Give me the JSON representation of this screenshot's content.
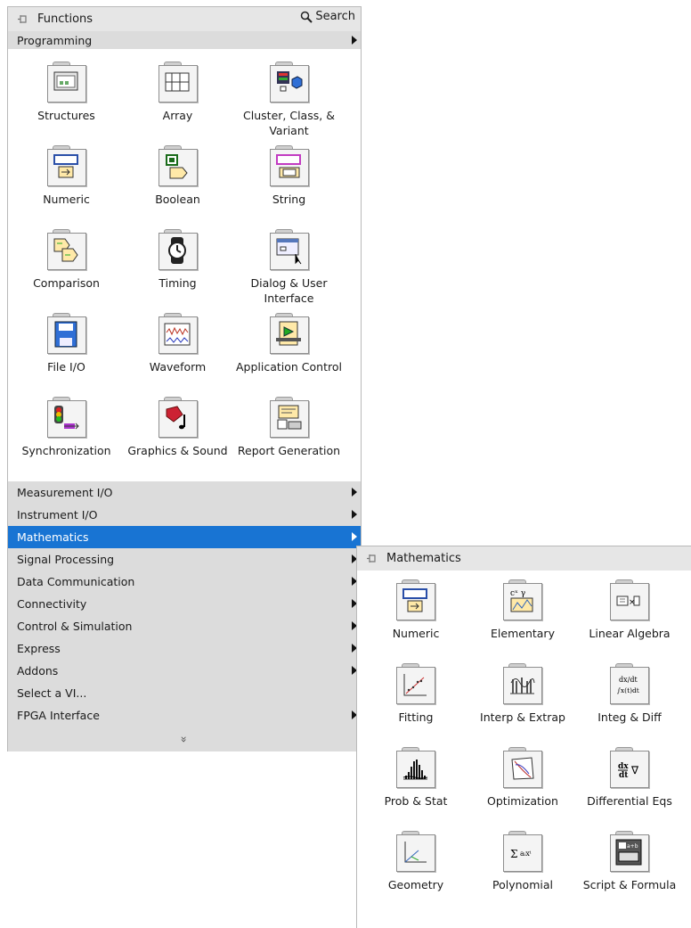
{
  "functions_palette": {
    "title": "Functions",
    "search_label": "Search",
    "programming_label": "Programming",
    "programming_items": [
      {
        "label": "Structures",
        "icon": "structures-icon"
      },
      {
        "label": "Array",
        "icon": "array-icon"
      },
      {
        "label": "Cluster, Class, & Variant",
        "icon": "cluster-icon"
      },
      {
        "label": "Numeric",
        "icon": "numeric-icon"
      },
      {
        "label": "Boolean",
        "icon": "boolean-icon"
      },
      {
        "label": "String",
        "icon": "string-icon"
      },
      {
        "label": "Comparison",
        "icon": "comparison-icon"
      },
      {
        "label": "Timing",
        "icon": "timing-icon"
      },
      {
        "label": "Dialog & User Interface",
        "icon": "dialog-icon"
      },
      {
        "label": "File I/O",
        "icon": "file-io-icon"
      },
      {
        "label": "Waveform",
        "icon": "waveform-icon"
      },
      {
        "label": "Application Control",
        "icon": "app-control-icon"
      },
      {
        "label": "Synchronization",
        "icon": "synchronization-icon"
      },
      {
        "label": "Graphics & Sound",
        "icon": "graphics-sound-icon"
      },
      {
        "label": "Report Generation",
        "icon": "report-icon"
      }
    ],
    "categories": [
      {
        "label": "Measurement I/O",
        "submenu": true
      },
      {
        "label": "Instrument I/O",
        "submenu": true
      },
      {
        "label": "Mathematics",
        "submenu": true,
        "selected": true
      },
      {
        "label": "Signal Processing",
        "submenu": true
      },
      {
        "label": "Data Communication",
        "submenu": true
      },
      {
        "label": "Connectivity",
        "submenu": true
      },
      {
        "label": "Control & Simulation",
        "submenu": true
      },
      {
        "label": "Express",
        "submenu": true
      },
      {
        "label": "Addons",
        "submenu": true
      },
      {
        "label": "Select a VI...",
        "submenu": false
      },
      {
        "label": "FPGA Interface",
        "submenu": true
      }
    ],
    "more_glyph": "»"
  },
  "math_palette": {
    "title": "Mathematics",
    "items": [
      {
        "label": "Numeric",
        "icon": "numeric-icon"
      },
      {
        "label": "Elementary",
        "icon": "elementary-icon"
      },
      {
        "label": "Linear Algebra",
        "icon": "linear-algebra-icon"
      },
      {
        "label": "Fitting",
        "icon": "fitting-icon"
      },
      {
        "label": "Interp & Extrap",
        "icon": "interp-icon"
      },
      {
        "label": "Integ & Diff",
        "icon": "integ-diff-icon"
      },
      {
        "label": "Prob & Stat",
        "icon": "prob-stat-icon"
      },
      {
        "label": "Optimization",
        "icon": "optimization-icon"
      },
      {
        "label": "Differential Eqs",
        "icon": "differential-icon"
      },
      {
        "label": "Geometry",
        "icon": "geometry-icon"
      },
      {
        "label": "Polynomial",
        "icon": "polynomial-icon"
      },
      {
        "label": "Script & Formula",
        "icon": "script-formula-icon"
      }
    ]
  },
  "colors": {
    "selection": "#1874d3",
    "category_bg": "#dcdcdc",
    "titlebar_bg": "#e6e6e6"
  }
}
